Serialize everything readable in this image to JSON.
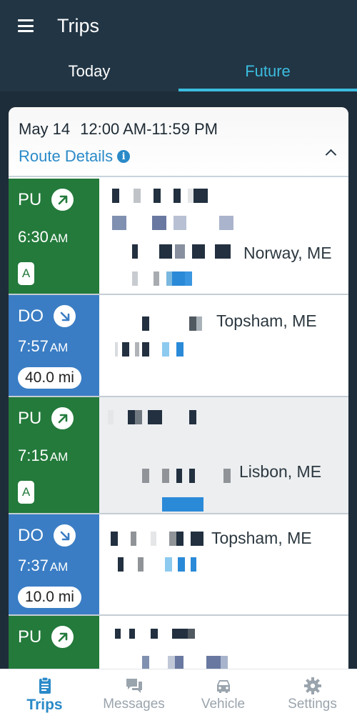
{
  "app": {
    "title": "Trips"
  },
  "tabs": [
    {
      "label": "Today",
      "active": false
    },
    {
      "label": "Future",
      "active": true
    }
  ],
  "route": {
    "date": "May 14",
    "time_range": "12:00 AM-11:59 PM",
    "details_label": "Route Details",
    "info_icon": "i"
  },
  "stops": [
    {
      "type": "PU",
      "time": "6:30",
      "ampm": "AM",
      "badge": "A",
      "city": "Norway, ME"
    },
    {
      "type": "DO",
      "time": "7:57",
      "ampm": "AM",
      "distance": "40.0 mi",
      "city": "Topsham, ME"
    },
    {
      "type": "PU",
      "time": "7:15",
      "ampm": "AM",
      "badge": "A",
      "city": "Lisbon, ME"
    },
    {
      "type": "DO",
      "time": "7:37",
      "ampm": "AM",
      "distance": "10.0 mi",
      "city": "Topsham, ME"
    },
    {
      "type": "PU"
    }
  ],
  "bottom_nav": [
    {
      "label": "Trips",
      "icon": "clipboard-icon",
      "active": true
    },
    {
      "label": "Messages",
      "icon": "chat-icon",
      "active": false
    },
    {
      "label": "Vehicle",
      "icon": "car-icon",
      "active": false
    },
    {
      "label": "Settings",
      "icon": "gear-icon",
      "active": false
    }
  ],
  "colors": {
    "appbar": "#223544",
    "accent": "#3bbde0",
    "pickup": "#237a3b",
    "dropoff": "#3a7dc4",
    "link": "#2a8ac8"
  }
}
